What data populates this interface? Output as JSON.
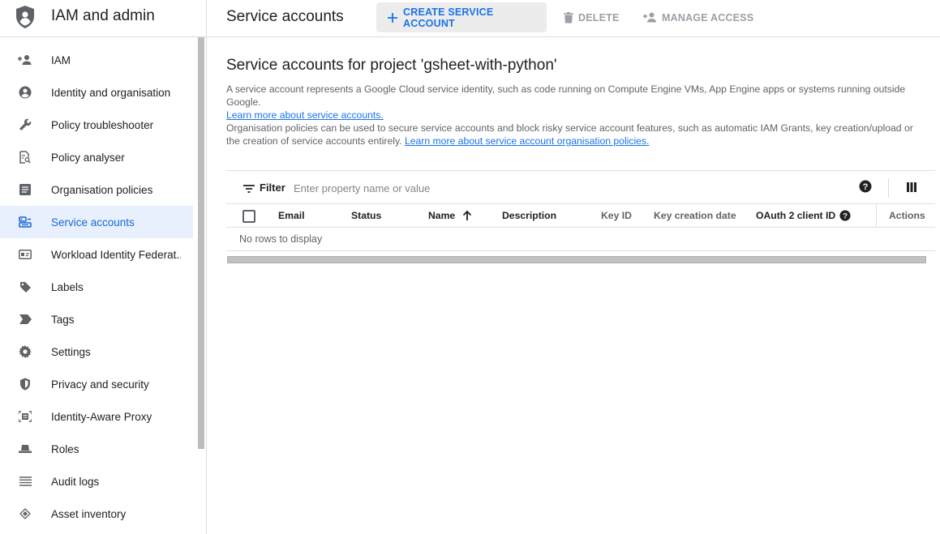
{
  "sidebar": {
    "title": "IAM and admin",
    "items": [
      {
        "label": "IAM",
        "icon": "person-add-icon"
      },
      {
        "label": "Identity and organisation",
        "icon": "account-circle-icon"
      },
      {
        "label": "Policy troubleshooter",
        "icon": "wrench-icon"
      },
      {
        "label": "Policy analyser",
        "icon": "document-search-icon"
      },
      {
        "label": "Organisation policies",
        "icon": "list-document-icon"
      },
      {
        "label": "Service accounts",
        "icon": "service-account-icon",
        "active": true
      },
      {
        "label": "Workload Identity Federat...",
        "icon": "id-card-icon"
      },
      {
        "label": "Labels",
        "icon": "tag-icon"
      },
      {
        "label": "Tags",
        "icon": "label-arrow-icon"
      },
      {
        "label": "Settings",
        "icon": "gear-icon"
      },
      {
        "label": "Privacy and security",
        "icon": "shield-icon"
      },
      {
        "label": "Identity-Aware Proxy",
        "icon": "proxy-icon"
      },
      {
        "label": "Roles",
        "icon": "hat-icon"
      },
      {
        "label": "Audit logs",
        "icon": "list-icon"
      },
      {
        "label": "Asset inventory",
        "icon": "diamond-layers-icon"
      }
    ]
  },
  "toolbar": {
    "page_title": "Service accounts",
    "create_label": "CREATE SERVICE ACCOUNT",
    "delete_label": "DELETE",
    "manage_label": "MANAGE ACCESS"
  },
  "main": {
    "heading": "Service accounts for project 'gsheet-with-python'",
    "desc1": "A service account represents a Google Cloud service identity, such as code running on Compute Engine VMs, App Engine apps or systems running outside Google.",
    "desc1_link": "Learn more about service accounts.",
    "desc2": "Organisation policies can be used to secure service accounts and block risky service account features, such as automatic IAM Grants, key creation/upload or the creation of service accounts entirely.",
    "desc2_link": "Learn more about service account organisation policies.",
    "filter_label": "Filter",
    "filter_placeholder": "Enter property name or value",
    "columns": {
      "email": "Email",
      "status": "Status",
      "name": "Name",
      "description": "Description",
      "key_id": "Key ID",
      "key_creation_date": "Key creation date",
      "oauth_client_id": "OAuth 2 client ID",
      "actions": "Actions"
    },
    "empty_text": "No rows to display"
  },
  "colors": {
    "accent": "#1a73e8",
    "active_bg": "#e8f0fe",
    "muted": "#5f6368",
    "disabled": "#9aa0a6"
  }
}
